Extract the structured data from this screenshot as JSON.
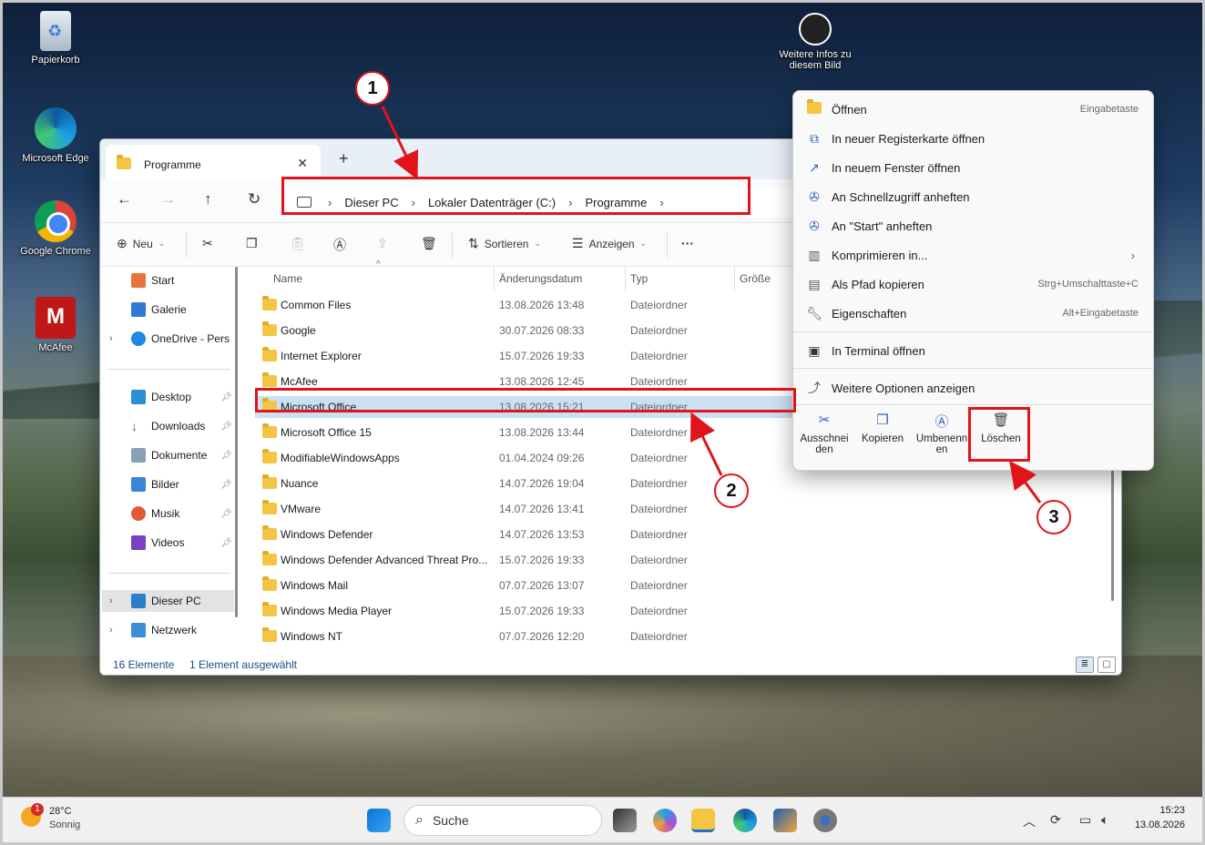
{
  "desktop": {
    "icons": [
      "Papierkorb",
      "Microsoft Edge",
      "Google Chrome",
      "McAfee"
    ],
    "info_label_1": "Weitere Infos zu",
    "info_label_2": "diesem Bild"
  },
  "explorer": {
    "tab_title": "Programme",
    "breadcrumb": [
      "Dieser PC",
      "Lokaler Datenträger (C:)",
      "Programme"
    ],
    "toolbar": {
      "new_label": "Neu",
      "sort_label": "Sortieren",
      "view_label": "Anzeigen",
      "more_label": "···"
    },
    "sidebar": {
      "start": "Start",
      "gallery": "Galerie",
      "onedrive": "OneDrive - Pers",
      "desktop": "Desktop",
      "downloads": "Downloads",
      "documents": "Dokumente",
      "pictures": "Bilder",
      "music": "Musik",
      "videos": "Videos",
      "this_pc": "Dieser PC",
      "network": "Netzwerk"
    },
    "columns": {
      "name": "Name",
      "date": "Änderungsdatum",
      "type": "Typ",
      "size": "Größe"
    },
    "files": [
      {
        "name": "Common Files",
        "date": "13.08.2026 13:48",
        "type": "Dateiordner"
      },
      {
        "name": "Google",
        "date": "30.07.2026 08:33",
        "type": "Dateiordner"
      },
      {
        "name": "Internet Explorer",
        "date": "15.07.2026 19:33",
        "type": "Dateiordner"
      },
      {
        "name": "McAfee",
        "date": "13.08.2026 12:45",
        "type": "Dateiordner"
      },
      {
        "name": "Microsoft Office",
        "date": "13.08.2026 15:21",
        "type": "Dateiordner"
      },
      {
        "name": "Microsoft Office 15",
        "date": "13.08.2026 13:44",
        "type": "Dateiordner"
      },
      {
        "name": "ModifiableWindowsApps",
        "date": "01.04.2024 09:26",
        "type": "Dateiordner"
      },
      {
        "name": "Nuance",
        "date": "14.07.2026 19:04",
        "type": "Dateiordner"
      },
      {
        "name": "VMware",
        "date": "14.07.2026 13:41",
        "type": "Dateiordner"
      },
      {
        "name": "Windows Defender",
        "date": "14.07.2026 13:53",
        "type": "Dateiordner"
      },
      {
        "name": "Windows Defender Advanced Threat Pro...",
        "date": "15.07.2026 19:33",
        "type": "Dateiordner"
      },
      {
        "name": "Windows Mail",
        "date": "07.07.2026 13:07",
        "type": "Dateiordner"
      },
      {
        "name": "Windows Media Player",
        "date": "15.07.2026 19:33",
        "type": "Dateiordner"
      },
      {
        "name": "Windows NT",
        "date": "07.07.2026 12:20",
        "type": "Dateiordner"
      }
    ],
    "status": {
      "count": "16 Elemente",
      "selection": "1 Element ausgewählt"
    }
  },
  "context_menu": {
    "items": [
      {
        "label": "Öffnen",
        "shortcut": "Eingabetaste"
      },
      {
        "label": "In neuer Registerkarte öffnen",
        "shortcut": ""
      },
      {
        "label": "In neuem Fenster öffnen",
        "shortcut": ""
      },
      {
        "label": "An Schnellzugriff anheften",
        "shortcut": ""
      },
      {
        "label": "An \"Start\" anheften",
        "shortcut": ""
      },
      {
        "label": "Komprimieren in...",
        "shortcut": ""
      },
      {
        "label": "Als Pfad kopieren",
        "shortcut": "Strg+Umschalttaste+C"
      },
      {
        "label": "Eigenschaften",
        "shortcut": "Alt+Eingabetaste"
      },
      {
        "label": "In Terminal öffnen",
        "shortcut": ""
      },
      {
        "label": "Weitere Optionen anzeigen",
        "shortcut": ""
      }
    ],
    "quick_actions": {
      "cut_1": "Ausschnei",
      "cut_2": "den",
      "copy": "Kopieren",
      "rename_1": "Umbenenn",
      "rename_2": "en",
      "delete": "Löschen"
    }
  },
  "annotations": {
    "one": "1",
    "two": "2",
    "three": "3",
    "accent": "#e0141a"
  },
  "taskbar": {
    "weather_temp": "28°C",
    "weather_desc": "Sonnig",
    "weather_badge": "1",
    "search_placeholder": "Suche",
    "time": "15:23",
    "date": "13.08.2026"
  }
}
